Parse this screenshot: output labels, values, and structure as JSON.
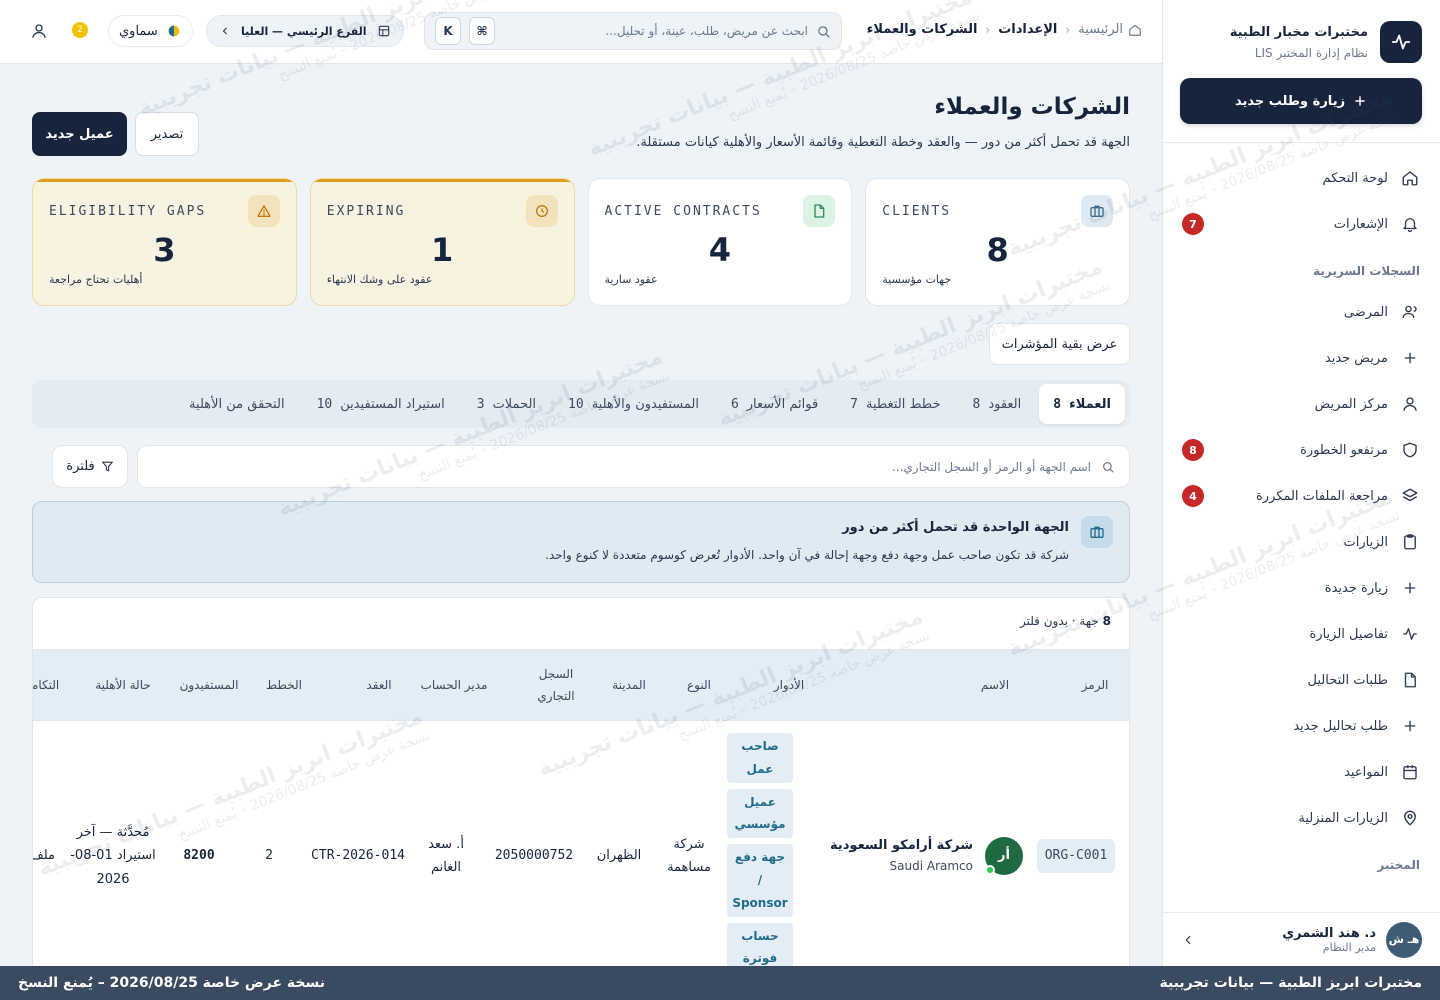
{
  "brand": {
    "name": "مختبرات مخبار الطبية",
    "subtitle": "نظام إدارة المختبر LIS"
  },
  "sidebar": {
    "new_visit_label": "زيارة وطلب جديد",
    "items": [
      {
        "label": "لوحة التحكم",
        "icon": "home-icon"
      },
      {
        "label": "الإشعارات",
        "icon": "bell-icon",
        "badge": "7"
      },
      {
        "section": "السجلات السريرية"
      },
      {
        "label": "المرضى",
        "icon": "users-icon"
      },
      {
        "label": "مريض جديد",
        "icon": "plus-icon"
      },
      {
        "label": "مركز المريض",
        "icon": "user-icon"
      },
      {
        "label": "مرتفعو الخطورة",
        "icon": "shield-icon",
        "badge": "8"
      },
      {
        "label": "مراجعة الملفات المكررة",
        "icon": "layers-icon",
        "badge": "4"
      },
      {
        "label": "الزيارات",
        "icon": "clipboard-icon"
      },
      {
        "label": "زيارة جديدة",
        "icon": "plus-icon"
      },
      {
        "label": "تفاصيل الزيارة",
        "icon": "activity-icon"
      },
      {
        "label": "طلبات التحاليل",
        "icon": "file-icon"
      },
      {
        "label": "طلب تحاليل جديد",
        "icon": "plus-icon"
      },
      {
        "label": "المواعيد",
        "icon": "calendar-icon"
      },
      {
        "label": "الزيارات المنزلية",
        "icon": "map-pin-icon"
      },
      {
        "section": "المختبر"
      }
    ],
    "user": {
      "initials": "هـ ش",
      "name": "د. هند الشمري",
      "role": "مدير النظام"
    }
  },
  "topbar": {
    "breadcrumb": {
      "home": "الرئيسية",
      "settings": "الإعدادات",
      "current": "الشركات والعملاء"
    },
    "search_placeholder": "ابحث عن مريض، طلب، عينة، أو تحليل...",
    "kbd_k": "K",
    "kbd_cmd": "⌘",
    "branch": "الفرع الرئيسي — العليا",
    "theme": "سماوي",
    "notif_count": "2"
  },
  "page": {
    "title": "الشركات والعملاء",
    "subtitle": "الجهة قد تحمل أكثر من دور — والعقد وخطة التغطية وقائمة الأسعار والأهلية كيانات مستقلة.",
    "new_client": "عميل جديد",
    "export": "تصدير",
    "more_kpis": "عرض بقية المؤشرات"
  },
  "kpis": [
    {
      "label": "CLIENTS",
      "value": "8",
      "caption": "جهات مؤسسية",
      "icon": "briefcase-icon",
      "tone": "normal",
      "icon_bg": "#dde9f3",
      "icon_color": "#3e6b8a"
    },
    {
      "label": "ACTIVE CONTRACTS",
      "value": "4",
      "caption": "عقود سارية",
      "icon": "file-icon",
      "tone": "normal",
      "icon_bg": "#dcf2e4",
      "icon_color": "#2e8b57"
    },
    {
      "label": "EXPIRING",
      "value": "1",
      "caption": "عقود على وشك الانتهاء",
      "icon": "clock-icon",
      "tone": "warn",
      "icon_bg": "#f3e3bd",
      "icon_color": "#c27a10"
    },
    {
      "label": "ELIGIBILITY GAPS",
      "value": "3",
      "caption": "أهليات تحتاج مراجعة",
      "icon": "alert-triangle-icon",
      "tone": "warn",
      "icon_bg": "#f3e3bd",
      "icon_color": "#c27a10"
    }
  ],
  "tabs": [
    {
      "label": "العملاء",
      "count": "8",
      "active": true
    },
    {
      "label": "العقود",
      "count": "8"
    },
    {
      "label": "خطط التغطية",
      "count": "7"
    },
    {
      "label": "قوائم الأسعار",
      "count": "6"
    },
    {
      "label": "المستفيدون والأهلية",
      "count": "10"
    },
    {
      "label": "الحملات",
      "count": "3"
    },
    {
      "label": "استيراد المستفيدين",
      "count": "10"
    },
    {
      "label": "التحقق من الأهلية",
      "count": ""
    }
  ],
  "filter": {
    "placeholder": "اسم الجهة أو الرمز أو السجل التجاري...",
    "button": "فلترة"
  },
  "info": {
    "title": "الجهة الواحدة قد تحمل أكثر من دور",
    "text": "شركة قد تكون صاحب عمل وجهة دفع وجهة إحالة في آن واحد. الأدوار تُعرض كوسوم متعددة لا كنوع واحد."
  },
  "table": {
    "count": "8",
    "meta_rest": "جهة · بدون فلتر",
    "headers": {
      "code": "الرمز",
      "name": "الاسم",
      "roles": "الأدوار",
      "type": "النوع",
      "city": "المدينة",
      "cr": "السجل التجاري",
      "manager": "مدير الحساب",
      "contract": "العقد",
      "plans": "الخطط",
      "beneficiaries": "المستفيدون",
      "eligibility": "حالة الأهلية",
      "integration": "التكامل"
    },
    "rows": [
      {
        "code": "ORG-C001",
        "avatar": "أر",
        "name_ar": "شركة أرامكو السعودية",
        "name_en": "Saudi Aramco",
        "roles": [
          "صاحب عمل",
          "عميل مؤسسي",
          "جهة دفع / Sponsor",
          "حساب فوترة"
        ],
        "type": "شركة مساهمة",
        "city": "الظهران",
        "cr": "2050000752",
        "manager": "أ. سعد الغانم",
        "contract": "CTR-2026-014",
        "plans": "2",
        "beneficiaries": "8200",
        "eligibility": "مُحدَّثة — آخر استيراد 01-08-2026",
        "integration": "ملف مجمع"
      }
    ]
  },
  "footer": {
    "right": "مختبرات ابريز الطبية — بيانات تجريبية",
    "left": "نسخة عرض خاصة 2026/08/25 – يُمنع النسخ"
  },
  "watermark": {
    "line1": "مختبرات ابريز الطبية — بيانات تجريبية",
    "line2": "نسخة عرض خاصة 2026/08/25 – يُمنع النسخ"
  }
}
